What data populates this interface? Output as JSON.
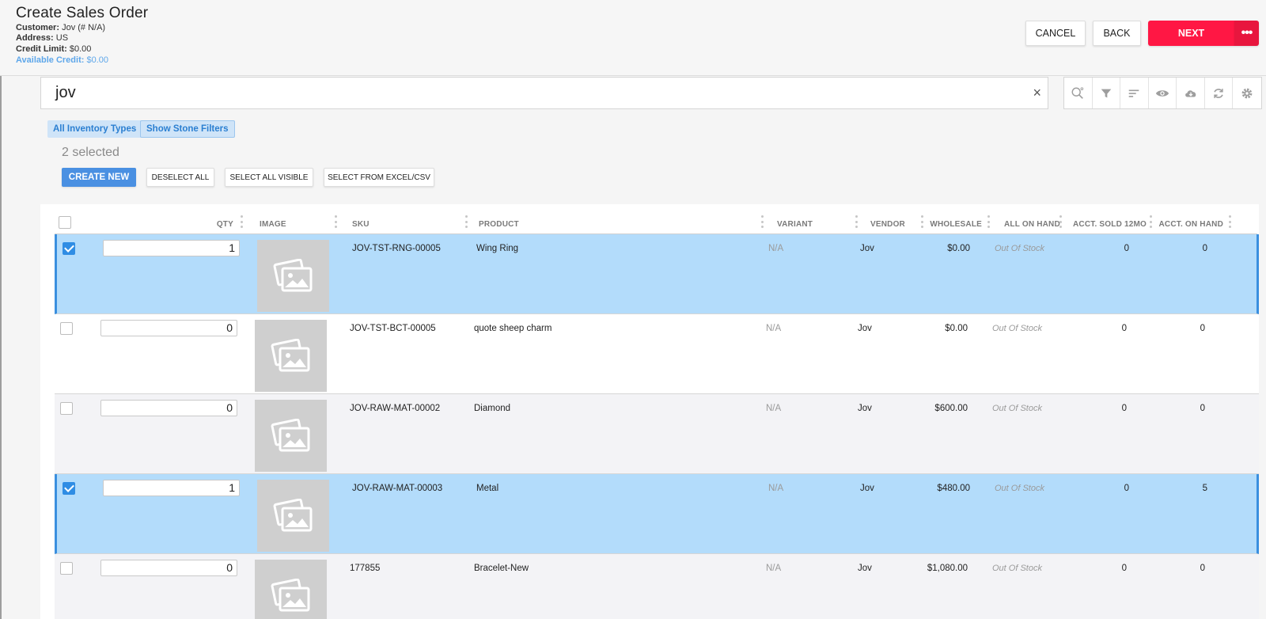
{
  "header": {
    "title": "Create Sales Order",
    "customer_label": "Customer:",
    "customer_value": "Jov (# N/A)",
    "address_label": "Address:",
    "address_value": "US",
    "credit_limit_label": "Credit Limit:",
    "credit_limit_value": "$0.00",
    "available_credit_label": "Available Credit:",
    "available_credit_value": "$0.00",
    "cancel_label": "CANCEL",
    "back_label": "BACK",
    "next_label": "NEXT",
    "more_label": "•••"
  },
  "colors": {
    "accent": "#ff1744",
    "selected_row": "#b3dcfb",
    "primary_button": "#4a90e2",
    "link_blue": "#5ea7ea"
  },
  "search": {
    "value": "jov",
    "clear_icon": "×"
  },
  "toolbar_icons": [
    "zoom-search-icon",
    "filter-icon",
    "sort-icon",
    "eye-icon",
    "cloud-download-icon",
    "refresh-icon",
    "gear-icon"
  ],
  "filters": {
    "inventory_types": "All Inventory Types",
    "stone_filters": "Show Stone Filters"
  },
  "selection": {
    "count_text": "2 selected"
  },
  "actions": {
    "create_new": "CREATE NEW",
    "deselect_all": "DESELECT ALL",
    "select_all_visible": "SELECT ALL VISIBLE",
    "select_from_excel": "SELECT FROM EXCEL/CSV"
  },
  "table": {
    "columns": {
      "qty": "QTY",
      "image": "IMAGE",
      "sku": "SKU",
      "product": "PRODUCT",
      "variant": "VARIANT",
      "vendor": "VENDOR",
      "wholesale": "WHOLESALE",
      "all_on_hand": "ALL ON HAND",
      "acct_sold": "ACCT. SOLD 12MO",
      "acct_on_hand": "ACCT. ON HAND"
    },
    "rows": [
      {
        "checked": true,
        "qty": "1",
        "sku": "JOV-TST-RNG-00005",
        "product": "Wing Ring",
        "variant": "N/A",
        "vendor": "Jov",
        "wholesale": "$0.00",
        "all_on_hand": "Out Of Stock",
        "acct_sold": "0",
        "acct_on_hand": "0"
      },
      {
        "checked": false,
        "qty": "0",
        "sku": "JOV-TST-BCT-00005",
        "product": "quote sheep charm",
        "variant": "N/A",
        "vendor": "Jov",
        "wholesale": "$0.00",
        "all_on_hand": "Out Of Stock",
        "acct_sold": "0",
        "acct_on_hand": "0"
      },
      {
        "checked": false,
        "qty": "0",
        "sku": "JOV-RAW-MAT-00002",
        "product": "Diamond",
        "variant": "N/A",
        "vendor": "Jov",
        "wholesale": "$600.00",
        "all_on_hand": "Out Of Stock",
        "acct_sold": "0",
        "acct_on_hand": "0"
      },
      {
        "checked": true,
        "qty": "1",
        "sku": "JOV-RAW-MAT-00003",
        "product": "Metal",
        "variant": "N/A",
        "vendor": "Jov",
        "wholesale": "$480.00",
        "all_on_hand": "Out Of Stock",
        "acct_sold": "0",
        "acct_on_hand": "5"
      },
      {
        "checked": false,
        "qty": "0",
        "sku": "177855",
        "product": "Bracelet-New",
        "variant": "N/A",
        "vendor": "Jov",
        "wholesale": "$1,080.00",
        "all_on_hand": "Out Of Stock",
        "acct_sold": "0",
        "acct_on_hand": "0"
      }
    ]
  }
}
